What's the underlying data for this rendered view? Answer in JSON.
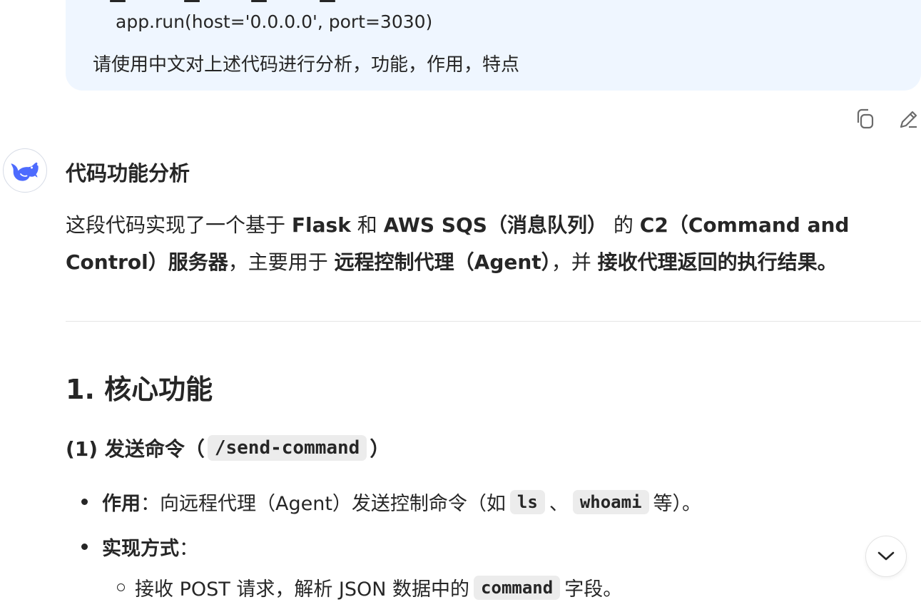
{
  "user_message": {
    "code_line": "app.run(host='0.0.0.0', port=3030)",
    "prompt": "请使用中文对上述代码进行分析，功能，作用，特点"
  },
  "message_actions": {
    "copy_icon": "copy-icon",
    "edit_icon": "edit-icon"
  },
  "assistant": {
    "avatar_icon": "deepseek-whale-icon",
    "heading": "代码功能分析",
    "intro": {
      "t1": "这段代码实现了一个基于 ",
      "b1": "Flask",
      "t2": " 和 ",
      "b2": "AWS SQS（消息队列）",
      "t3": " 的 ",
      "b3": "C2（Command and Control）服务器",
      "t4": "，主要用于 ",
      "b4": "远程控制代理（Agent）",
      "t5": "，并 ",
      "b5": "接收代理返回的执行结果。"
    },
    "section_title": "1. 核心功能",
    "sub_heading": {
      "prefix": "(1) 发送命令（",
      "code": "/send-command",
      "suffix": "）"
    },
    "bullets": {
      "b1_label": "作用",
      "b1_text1": "：向远程代理（Agent）发送控制命令（如 ",
      "b1_code1": "ls",
      "b1_sep": "、",
      "b1_code2": "whoami",
      "b1_text2": " 等）。",
      "b2_label": "实现方式",
      "b2_text": "：",
      "sub1_text1": "接收 POST 请求，解析 JSON 数据中的 ",
      "sub1_code": "command",
      "sub1_text2": " 字段。"
    }
  },
  "scroll_button": {
    "icon": "chevron-down-icon"
  },
  "colors": {
    "bubble_bg": "#eff6ff",
    "text": "#262626",
    "code_bg": "#ececec",
    "brand_blue": "#4d6bfe"
  }
}
